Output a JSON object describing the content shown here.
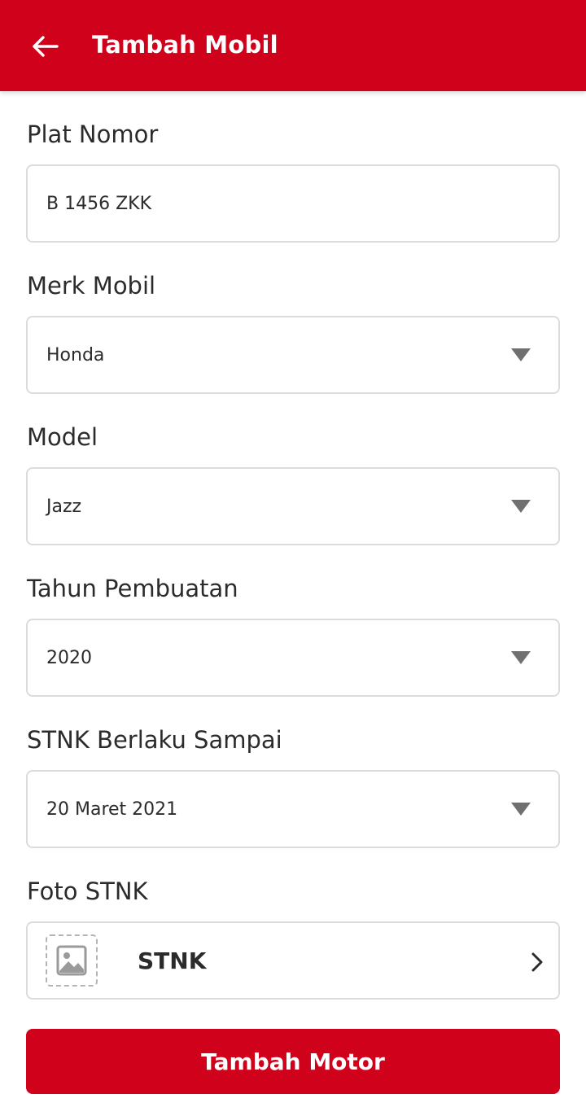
{
  "header": {
    "title": "Tambah Mobil",
    "back_icon": "arrow-left-icon",
    "color": "#d0011b"
  },
  "form": {
    "plate": {
      "label": "Plat Nomor",
      "value": "B 1456 ZKK"
    },
    "brand": {
      "label": "Merk Mobil",
      "value": "Honda"
    },
    "model": {
      "label": "Model",
      "value": "Jazz"
    },
    "year": {
      "label": "Tahun Pembuatan",
      "value": "2020"
    },
    "stnk_valid": {
      "label": "STNK Berlaku Sampai",
      "value": "20 Maret 2021"
    },
    "stnk_photo": {
      "label": "Foto STNK",
      "value": "STNK",
      "icon": "image-icon"
    }
  },
  "submit": {
    "label": "Tambah Motor",
    "color": "#d0011b"
  }
}
